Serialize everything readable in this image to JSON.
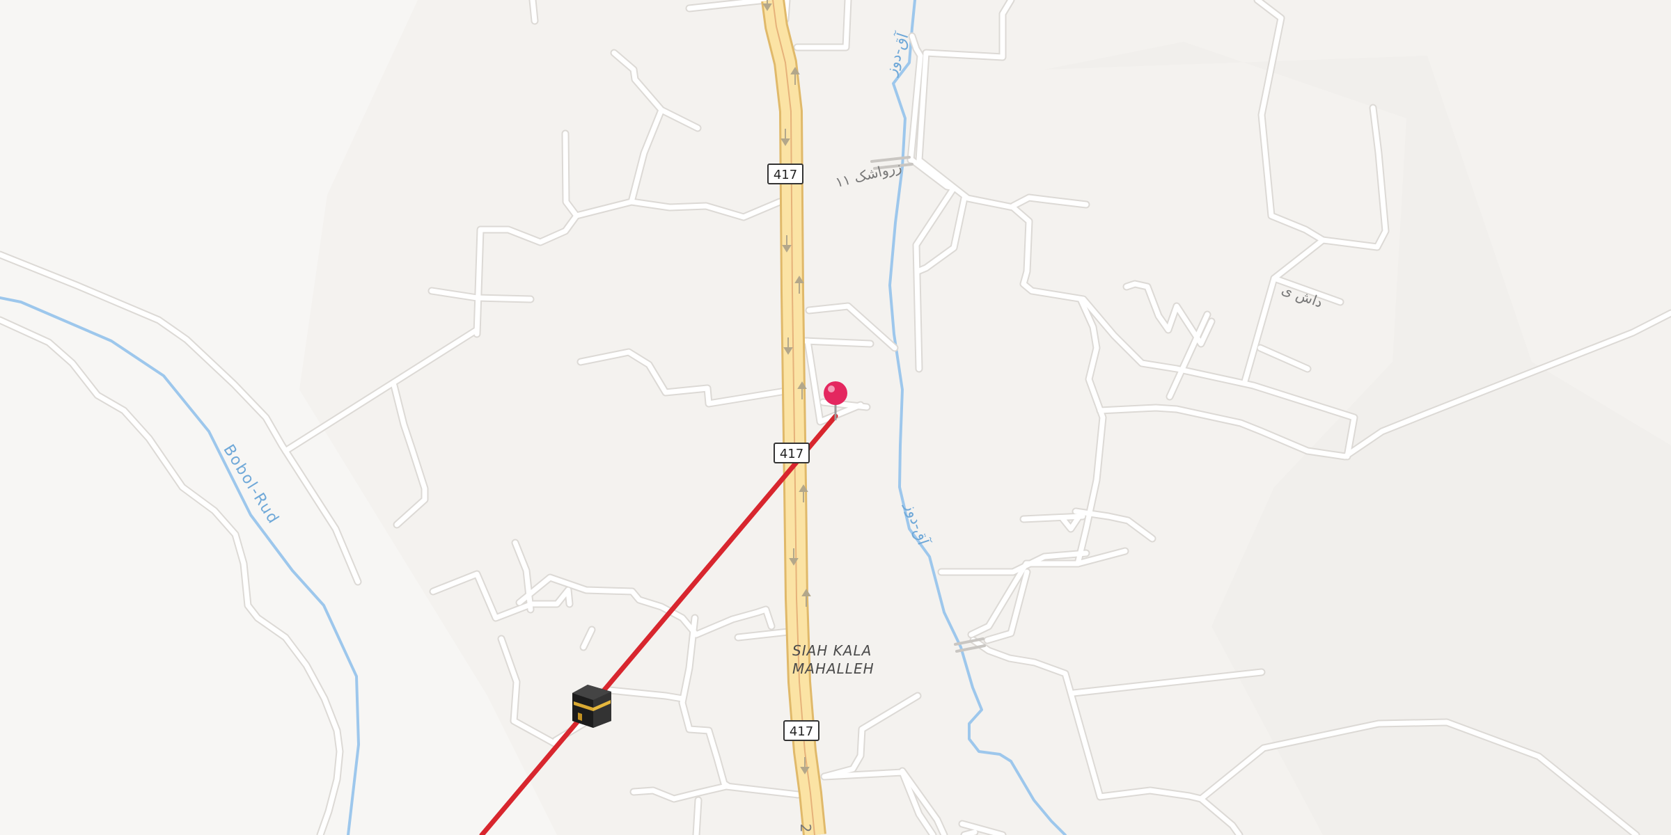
{
  "map": {
    "route_shields": [
      {
        "label": "417"
      },
      {
        "label": "417"
      },
      {
        "label": "417"
      }
    ],
    "place": {
      "line1": "SIAH KALA",
      "line2": "MAHALLEH"
    },
    "road_labels": {
      "north": "زرواشک ۱۱",
      "east": "داش ی",
      "south": "2"
    },
    "river_labels": {
      "west": "Bobol-Rud",
      "east_north": "آق-دوز",
      "east_mid": "آق-دوز"
    },
    "markers": {
      "pin": {
        "name": "destination-pin",
        "color": "#e4275f"
      },
      "kaaba": {
        "name": "kaaba-icon"
      }
    },
    "qibla_line_color": "#d8262e",
    "colors": {
      "background": "#f4f2ef",
      "road": "#ffffff",
      "road_edge": "#d9d6d2",
      "highway_fill": "#fbe3a4",
      "highway_edge": "#e0b96a",
      "water": "#9dc7ec"
    }
  }
}
